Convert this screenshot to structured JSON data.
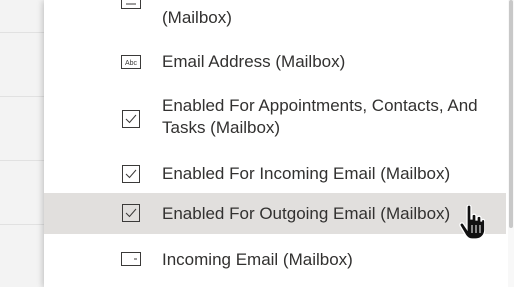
{
  "fields": [
    {
      "label": "(Mailbox)",
      "icon": "partial-field-icon"
    },
    {
      "label": "Email Address (Mailbox)",
      "icon": "text-field-icon"
    },
    {
      "label": "Enabled For Appointments, Contacts, And Tasks (Mailbox)",
      "icon": "checkbox-field-icon"
    },
    {
      "label": "Enabled For Incoming Email (Mailbox)",
      "icon": "checkbox-field-icon"
    },
    {
      "label": "Enabled For Outgoing Email (Mailbox)",
      "icon": "checkbox-field-icon",
      "state": "hover"
    },
    {
      "label": "Incoming Email (Mailbox)",
      "icon": "option-set-field-icon"
    }
  ],
  "colors": {
    "text": "#323130",
    "hover_background": "#e1dfdd",
    "icon_stroke": "#3b3a39"
  },
  "cursor": "hand-pointer-icon"
}
